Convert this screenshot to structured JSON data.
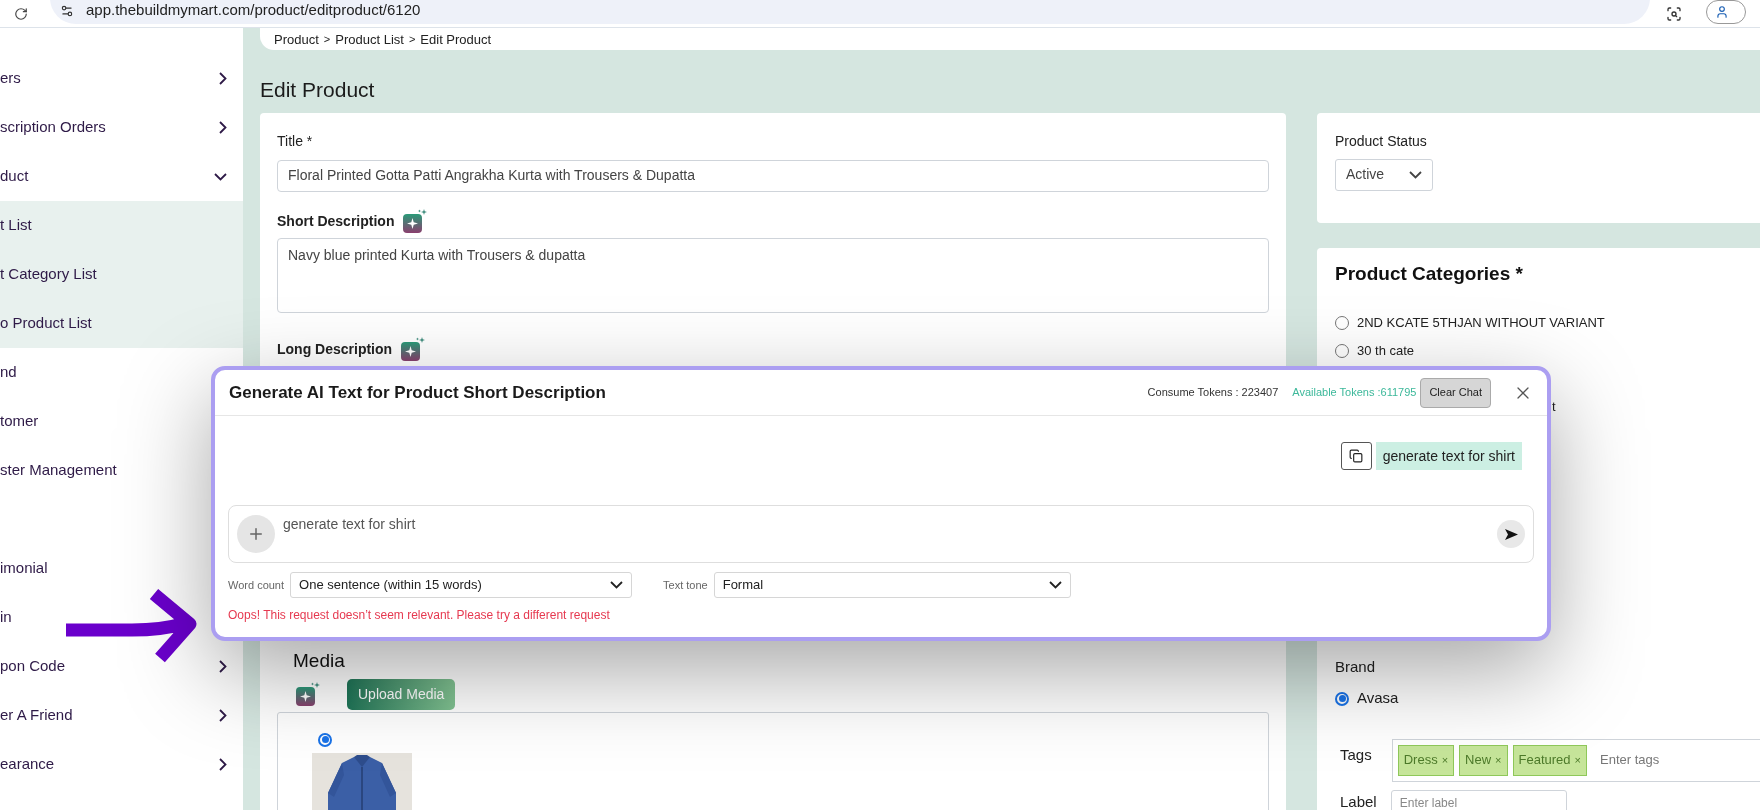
{
  "browser": {
    "url": "app.thebuildmymart.com/product/editproduct/6120"
  },
  "sidebar": {
    "sections": [
      [
        {
          "label": "ers",
          "expanded": false
        },
        {
          "label": "scription Orders",
          "expanded": false
        },
        {
          "label": "duct",
          "expanded": true,
          "children": [
            {
              "label": "t List"
            },
            {
              "label": "t Category List"
            },
            {
              "label": "o Product List"
            }
          ]
        },
        {
          "label": "nd"
        },
        {
          "label": "tomer"
        },
        {
          "label": "ster Management"
        }
      ],
      [
        {
          "label": "imonial"
        },
        {
          "label": "in"
        },
        {
          "label": "pon Code",
          "expanded": false
        },
        {
          "label": "er A Friend",
          "expanded": false
        },
        {
          "label": "earance",
          "expanded": false
        }
      ]
    ]
  },
  "breadcrumb": {
    "items": [
      "Product",
      "Product List",
      "Edit Product"
    ],
    "separator": ">"
  },
  "page_title": "Edit Product",
  "form": {
    "title": {
      "label": "Title *",
      "value": "Floral Printed Gotta Patti Angrakha Kurta with Trousers & Dupatta"
    },
    "short_description": {
      "label": "Short Description",
      "value": "Navy blue printed Kurta with Trousers & dupatta"
    },
    "long_description": {
      "label": "Long Description"
    },
    "media": {
      "heading": "Media",
      "upload_button": "Upload Media",
      "items": [
        {
          "kind": "picture",
          "selected": true
        }
      ]
    }
  },
  "status": {
    "label": "Product Status",
    "value": "Active"
  },
  "categories": {
    "heading": "Product Categories *",
    "items": [
      {
        "label": "2ND KCATE 5THJAN WITHOUT VARIANT",
        "selected": false
      },
      {
        "label": "30 th cate",
        "selected": false
      }
    ],
    "fragment": "t"
  },
  "brand": {
    "label": "Brand",
    "items": [
      {
        "label": "Avasa",
        "selected": true
      }
    ]
  },
  "tags": {
    "label": "Tags",
    "items": [
      {
        "text": "Dress",
        "remove": "×"
      },
      {
        "text": "New",
        "remove": "×"
      },
      {
        "text": "Featured",
        "remove": "×"
      }
    ],
    "placeholder": "Enter tags"
  },
  "label_field": {
    "label": "Label",
    "placeholder": "Enter label"
  },
  "ai_dialog": {
    "title": "Generate AI Text for Product Short Description",
    "consume_tokens": "Consume Tokens : 223407",
    "available_tokens": "Available Tokens :611795",
    "clear_button": "Clear Chat",
    "messages": [
      {
        "text": "generate text for shirt"
      }
    ],
    "prompt": {
      "value": "generate text for shirt"
    },
    "word_count": {
      "label": "Word count",
      "value": "One sentence (within 15 words)"
    },
    "text_tone": {
      "label": "Text tone",
      "value": "Formal"
    },
    "error": "Oops! This request doesn’t seem relevant. Please try a different request"
  }
}
